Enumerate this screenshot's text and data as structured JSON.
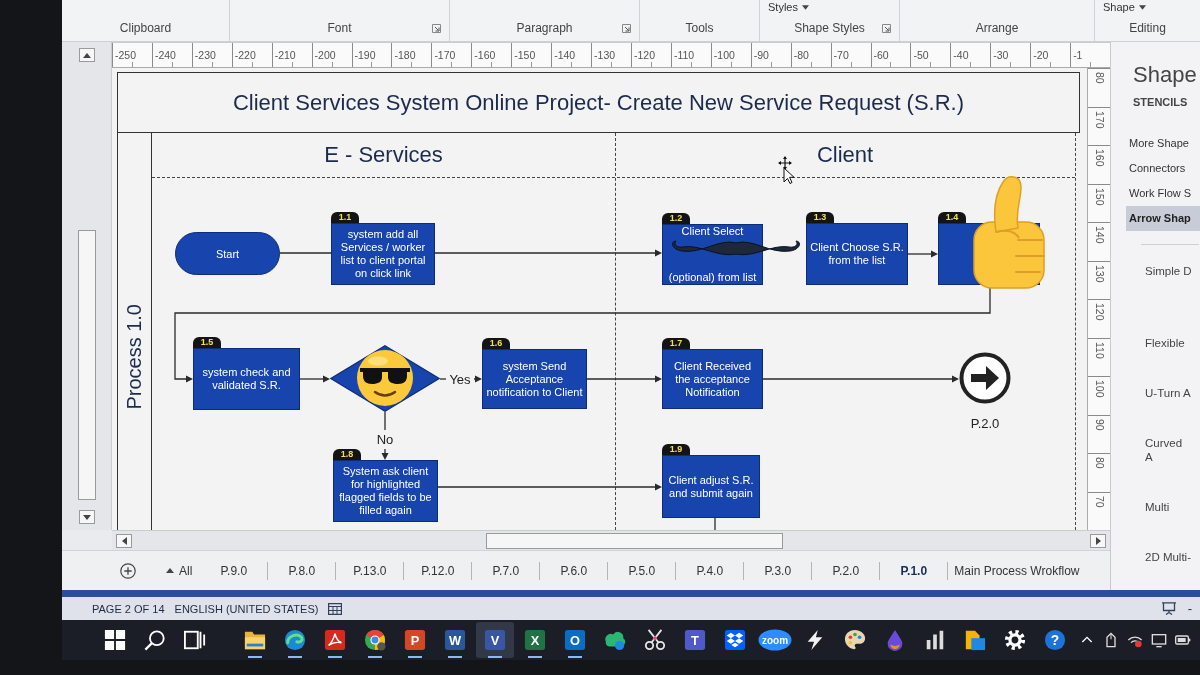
{
  "ribbon": {
    "groups": [
      {
        "label": "Clipboard",
        "launcher": false
      },
      {
        "label": "Font",
        "launcher": true
      },
      {
        "label": "Paragraph",
        "launcher": true
      },
      {
        "label": "Tools",
        "launcher": false
      },
      {
        "label": "Shape Styles",
        "launcher": true,
        "top_button": "Styles"
      },
      {
        "label": "Arrange",
        "launcher": false
      },
      {
        "label": "Editing",
        "launcher": false,
        "top_button": "Shape"
      }
    ]
  },
  "rulers": {
    "horizontal": [
      "-250",
      "-240",
      "-230",
      "-220",
      "-210",
      "-200",
      "-190",
      "-180",
      "-170",
      "-160",
      "-150",
      "-140",
      "-130",
      "-120",
      "-110",
      "-100",
      "-90",
      "-80",
      "-70",
      "-60",
      "-50",
      "-40",
      "-30",
      "-20",
      "-1"
    ],
    "vertical": [
      "80",
      "170",
      "160",
      "150",
      "140",
      "130",
      "120",
      "110",
      "100",
      "90",
      "80",
      "70"
    ]
  },
  "diagram": {
    "title": "Client Services System Online Project- Create New Service Request (S.R.)",
    "pool_label": "Process 1.0",
    "lanes": [
      {
        "label": "E - Services"
      },
      {
        "label": "Client"
      }
    ],
    "start": {
      "label": "Start"
    },
    "steps": [
      {
        "number": "1.1",
        "text": "system add all Services / worker list to client portal on click link"
      },
      {
        "number": "1.2",
        "text": "Client Select",
        "text_2": "(optional) from list"
      },
      {
        "number": "1.3",
        "text": "Client Choose S.R. from the list"
      },
      {
        "number": "1.4"
      },
      {
        "number": "1.5",
        "text": "system check and validated S.R."
      },
      {
        "number": "1.6",
        "text": "system Send Acceptance notification to Client"
      },
      {
        "number": "1.7",
        "text": "Client Received the acceptance Notification"
      },
      {
        "number": "1.8",
        "text": "System ask client for highlighted flagged fields to be filled again"
      },
      {
        "number": "1.9",
        "text": "Client adjust S.R. and submit again"
      }
    ],
    "yes_label": "Yes",
    "no_label": "No",
    "end": {
      "label": "P.2.0"
    },
    "stickers": [
      {
        "kind": "mustache"
      },
      {
        "kind": "thumbs-up"
      },
      {
        "kind": "sunglasses-face"
      }
    ]
  },
  "stencils": {
    "title": "Shape",
    "heading": "STENCILS",
    "items": [
      {
        "label": "More Shape",
        "selected": false
      },
      {
        "label": "Connectors",
        "selected": false
      },
      {
        "label": "Work Flow S",
        "selected": false
      },
      {
        "label": "Arrow Shap",
        "selected": true
      }
    ],
    "shapes": [
      {
        "lines": [
          "Simple D"
        ]
      },
      {
        "lines": [
          "Flexible"
        ]
      },
      {
        "lines": [
          "U-Turn A"
        ]
      },
      {
        "lines": [
          "Curved",
          "A"
        ]
      },
      {
        "lines": [
          "Multi"
        ]
      },
      {
        "lines": [
          "2D Multi-"
        ]
      }
    ]
  },
  "page_tabs": {
    "all_label": "All",
    "tabs": [
      {
        "label": "P.9.0",
        "selected": false
      },
      {
        "label": "P.8.0",
        "selected": false
      },
      {
        "label": "P.13.0",
        "selected": false
      },
      {
        "label": "P.12.0",
        "selected": false
      },
      {
        "label": "P.7.0",
        "selected": false
      },
      {
        "label": "P.6.0",
        "selected": false
      },
      {
        "label": "P.5.0",
        "selected": false
      },
      {
        "label": "P.4.0",
        "selected": false
      },
      {
        "label": "P.3.0",
        "selected": false
      },
      {
        "label": "P.2.0",
        "selected": false
      },
      {
        "label": "P.1.0",
        "selected": true
      },
      {
        "label": "Main Process Wrokflow",
        "selected": false
      }
    ]
  },
  "status_bar": {
    "page": "PAGE 2 OF 14",
    "language": "ENGLISH (UNITED STATES)",
    "zoom_out": "-"
  },
  "taskbar": {
    "items": [
      {
        "kind": "start",
        "running": false,
        "active": false
      },
      {
        "kind": "search",
        "running": false,
        "active": false
      },
      {
        "kind": "task-view",
        "running": false,
        "active": false
      },
      {
        "kind": "folder",
        "running": true,
        "active": false
      },
      {
        "kind": "wave-browser",
        "running": true,
        "active": false
      },
      {
        "kind": "pdf",
        "running": true,
        "active": false
      },
      {
        "kind": "ball-browser",
        "running": true,
        "active": false
      },
      {
        "kind": "slides",
        "glyph": "P",
        "running": true,
        "active": false
      },
      {
        "kind": "document",
        "glyph": "W",
        "running": true,
        "active": false
      },
      {
        "kind": "diagram",
        "glyph": "V",
        "running": true,
        "active": true
      },
      {
        "kind": "sheet",
        "glyph": "X",
        "running": true,
        "active": false
      },
      {
        "kind": "mail",
        "glyph": "O",
        "running": true,
        "active": false
      },
      {
        "kind": "cloud-app",
        "running": false,
        "active": false
      },
      {
        "kind": "scissors",
        "running": false,
        "active": false
      },
      {
        "kind": "chat",
        "glyph": "T",
        "running": false,
        "active": false
      },
      {
        "kind": "box",
        "running": false,
        "active": false
      },
      {
        "kind": "video",
        "glyph": "zoom",
        "running": false,
        "active": false
      },
      {
        "kind": "bolt",
        "running": false,
        "active": false
      },
      {
        "kind": "palette",
        "running": false,
        "active": false
      },
      {
        "kind": "drop",
        "running": false,
        "active": false
      },
      {
        "kind": "bars",
        "running": false,
        "active": false
      },
      {
        "kind": "file-folder",
        "running": false,
        "active": false
      },
      {
        "kind": "gear",
        "running": false,
        "active": false
      },
      {
        "kind": "help",
        "glyph": "?",
        "running": false,
        "active": false
      },
      {
        "kind": "chevron",
        "running": false,
        "active": false
      },
      {
        "kind": "pen",
        "running": false,
        "active": false
      },
      {
        "kind": "network",
        "running": false,
        "active": false
      },
      {
        "kind": "screen",
        "running": false,
        "active": false
      },
      {
        "kind": "battery",
        "running": false,
        "active": false
      }
    ]
  }
}
